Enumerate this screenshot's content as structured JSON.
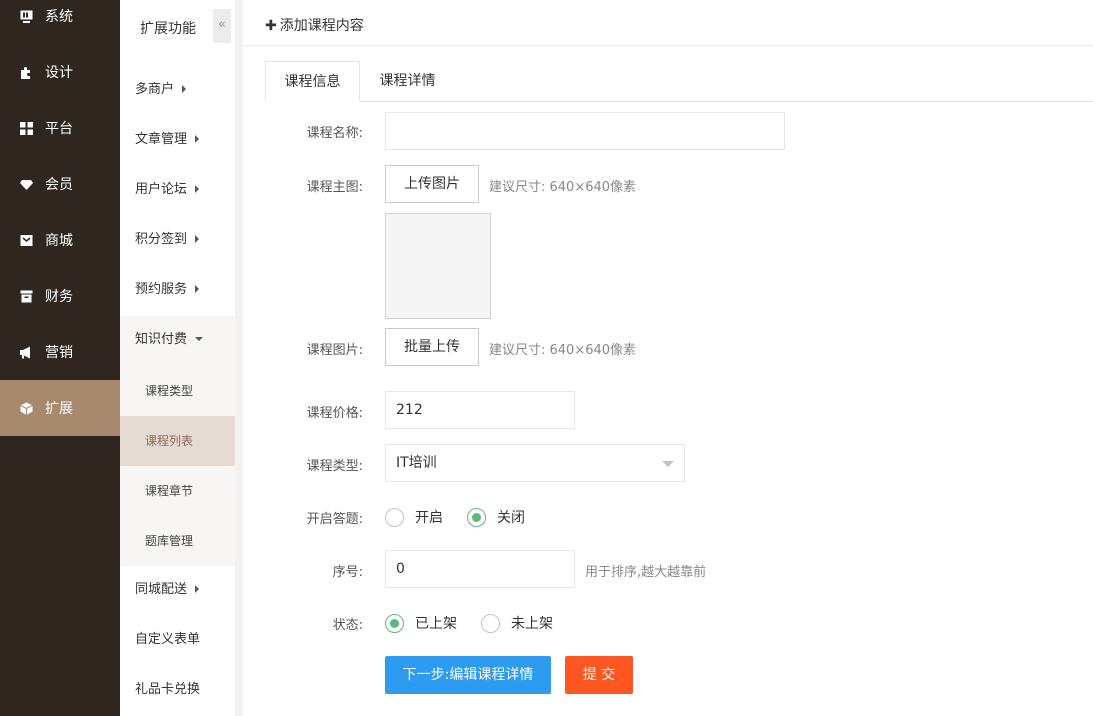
{
  "main_nav": {
    "items": [
      {
        "label": "系统",
        "icon": "monitor-icon"
      },
      {
        "label": "设计",
        "icon": "puzzle-icon"
      },
      {
        "label": "平台",
        "icon": "grid-icon"
      },
      {
        "label": "会员",
        "icon": "diamond-icon"
      },
      {
        "label": "商城",
        "icon": "mail-icon"
      },
      {
        "label": "财务",
        "icon": "archive-icon"
      },
      {
        "label": "营销",
        "icon": "megaphone-icon"
      },
      {
        "label": "扩展",
        "icon": "cube-icon"
      }
    ],
    "active_index": 7
  },
  "sub_nav": {
    "title": "扩展功能",
    "collapse_glyph": "«",
    "groups": [
      {
        "label": "多商户"
      },
      {
        "label": "文章管理"
      },
      {
        "label": "用户论坛"
      },
      {
        "label": "积分签到"
      },
      {
        "label": "预约服务"
      },
      {
        "label": "知识付费"
      },
      {
        "label": "同城配送"
      },
      {
        "label": "自定义表单"
      },
      {
        "label": "礼品卡兑换"
      }
    ],
    "children": [
      {
        "label": "课程类型"
      },
      {
        "label": "课程列表"
      },
      {
        "label": "课程章节"
      },
      {
        "label": "题库管理"
      }
    ]
  },
  "topbar": {
    "add_label": "添加课程内容",
    "plus": "✚"
  },
  "tabs": [
    {
      "label": "课程信息"
    },
    {
      "label": "课程详情"
    }
  ],
  "form": {
    "name_label": "课程名称:",
    "name_value": "",
    "main_image_label": "课程主图:",
    "upload_button": "上传图片",
    "main_image_hint": "建议尺寸: 640×640像素",
    "images_label": "课程图片:",
    "batch_upload_button": "批量上传",
    "images_hint": "建议尺寸: 640×640像素",
    "price_label": "课程价格:",
    "price_value": "212",
    "type_label": "课程类型:",
    "type_value": "IT培训",
    "quiz_label": "开启答题:",
    "quiz_options": [
      "开启",
      "关闭"
    ],
    "quiz_selected": "关闭",
    "order_label": "序号:",
    "order_value": "0",
    "order_hint": "用于排序,越大越靠前",
    "status_label": "状态:",
    "status_options": [
      "已上架",
      "未上架"
    ],
    "status_selected": "已上架",
    "next_button": "下一步:编辑课程详情",
    "submit_button": "提 交"
  },
  "colors": {
    "sidebar_bg": "#2f271f",
    "sidebar_active": "#a78a6e",
    "primary": "#2d9cf0",
    "danger": "#ff5722",
    "radio_on": "#5fb878"
  }
}
